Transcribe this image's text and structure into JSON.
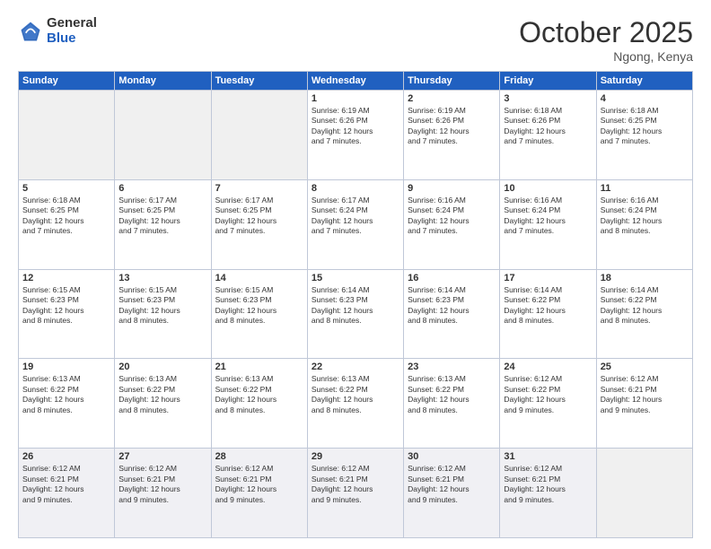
{
  "header": {
    "logo_general": "General",
    "logo_blue": "Blue",
    "month_title": "October 2025",
    "location": "Ngong, Kenya"
  },
  "days_of_week": [
    "Sunday",
    "Monday",
    "Tuesday",
    "Wednesday",
    "Thursday",
    "Friday",
    "Saturday"
  ],
  "weeks": [
    [
      {
        "num": "",
        "info": ""
      },
      {
        "num": "",
        "info": ""
      },
      {
        "num": "",
        "info": ""
      },
      {
        "num": "1",
        "info": "Sunrise: 6:19 AM\nSunset: 6:26 PM\nDaylight: 12 hours\nand 7 minutes."
      },
      {
        "num": "2",
        "info": "Sunrise: 6:19 AM\nSunset: 6:26 PM\nDaylight: 12 hours\nand 7 minutes."
      },
      {
        "num": "3",
        "info": "Sunrise: 6:18 AM\nSunset: 6:26 PM\nDaylight: 12 hours\nand 7 minutes."
      },
      {
        "num": "4",
        "info": "Sunrise: 6:18 AM\nSunset: 6:25 PM\nDaylight: 12 hours\nand 7 minutes."
      }
    ],
    [
      {
        "num": "5",
        "info": "Sunrise: 6:18 AM\nSunset: 6:25 PM\nDaylight: 12 hours\nand 7 minutes."
      },
      {
        "num": "6",
        "info": "Sunrise: 6:17 AM\nSunset: 6:25 PM\nDaylight: 12 hours\nand 7 minutes."
      },
      {
        "num": "7",
        "info": "Sunrise: 6:17 AM\nSunset: 6:25 PM\nDaylight: 12 hours\nand 7 minutes."
      },
      {
        "num": "8",
        "info": "Sunrise: 6:17 AM\nSunset: 6:24 PM\nDaylight: 12 hours\nand 7 minutes."
      },
      {
        "num": "9",
        "info": "Sunrise: 6:16 AM\nSunset: 6:24 PM\nDaylight: 12 hours\nand 7 minutes."
      },
      {
        "num": "10",
        "info": "Sunrise: 6:16 AM\nSunset: 6:24 PM\nDaylight: 12 hours\nand 7 minutes."
      },
      {
        "num": "11",
        "info": "Sunrise: 6:16 AM\nSunset: 6:24 PM\nDaylight: 12 hours\nand 8 minutes."
      }
    ],
    [
      {
        "num": "12",
        "info": "Sunrise: 6:15 AM\nSunset: 6:23 PM\nDaylight: 12 hours\nand 8 minutes."
      },
      {
        "num": "13",
        "info": "Sunrise: 6:15 AM\nSunset: 6:23 PM\nDaylight: 12 hours\nand 8 minutes."
      },
      {
        "num": "14",
        "info": "Sunrise: 6:15 AM\nSunset: 6:23 PM\nDaylight: 12 hours\nand 8 minutes."
      },
      {
        "num": "15",
        "info": "Sunrise: 6:14 AM\nSunset: 6:23 PM\nDaylight: 12 hours\nand 8 minutes."
      },
      {
        "num": "16",
        "info": "Sunrise: 6:14 AM\nSunset: 6:23 PM\nDaylight: 12 hours\nand 8 minutes."
      },
      {
        "num": "17",
        "info": "Sunrise: 6:14 AM\nSunset: 6:22 PM\nDaylight: 12 hours\nand 8 minutes."
      },
      {
        "num": "18",
        "info": "Sunrise: 6:14 AM\nSunset: 6:22 PM\nDaylight: 12 hours\nand 8 minutes."
      }
    ],
    [
      {
        "num": "19",
        "info": "Sunrise: 6:13 AM\nSunset: 6:22 PM\nDaylight: 12 hours\nand 8 minutes."
      },
      {
        "num": "20",
        "info": "Sunrise: 6:13 AM\nSunset: 6:22 PM\nDaylight: 12 hours\nand 8 minutes."
      },
      {
        "num": "21",
        "info": "Sunrise: 6:13 AM\nSunset: 6:22 PM\nDaylight: 12 hours\nand 8 minutes."
      },
      {
        "num": "22",
        "info": "Sunrise: 6:13 AM\nSunset: 6:22 PM\nDaylight: 12 hours\nand 8 minutes."
      },
      {
        "num": "23",
        "info": "Sunrise: 6:13 AM\nSunset: 6:22 PM\nDaylight: 12 hours\nand 8 minutes."
      },
      {
        "num": "24",
        "info": "Sunrise: 6:12 AM\nSunset: 6:22 PM\nDaylight: 12 hours\nand 9 minutes."
      },
      {
        "num": "25",
        "info": "Sunrise: 6:12 AM\nSunset: 6:21 PM\nDaylight: 12 hours\nand 9 minutes."
      }
    ],
    [
      {
        "num": "26",
        "info": "Sunrise: 6:12 AM\nSunset: 6:21 PM\nDaylight: 12 hours\nand 9 minutes."
      },
      {
        "num": "27",
        "info": "Sunrise: 6:12 AM\nSunset: 6:21 PM\nDaylight: 12 hours\nand 9 minutes."
      },
      {
        "num": "28",
        "info": "Sunrise: 6:12 AM\nSunset: 6:21 PM\nDaylight: 12 hours\nand 9 minutes."
      },
      {
        "num": "29",
        "info": "Sunrise: 6:12 AM\nSunset: 6:21 PM\nDaylight: 12 hours\nand 9 minutes."
      },
      {
        "num": "30",
        "info": "Sunrise: 6:12 AM\nSunset: 6:21 PM\nDaylight: 12 hours\nand 9 minutes."
      },
      {
        "num": "31",
        "info": "Sunrise: 6:12 AM\nSunset: 6:21 PM\nDaylight: 12 hours\nand 9 minutes."
      },
      {
        "num": "",
        "info": ""
      }
    ]
  ]
}
